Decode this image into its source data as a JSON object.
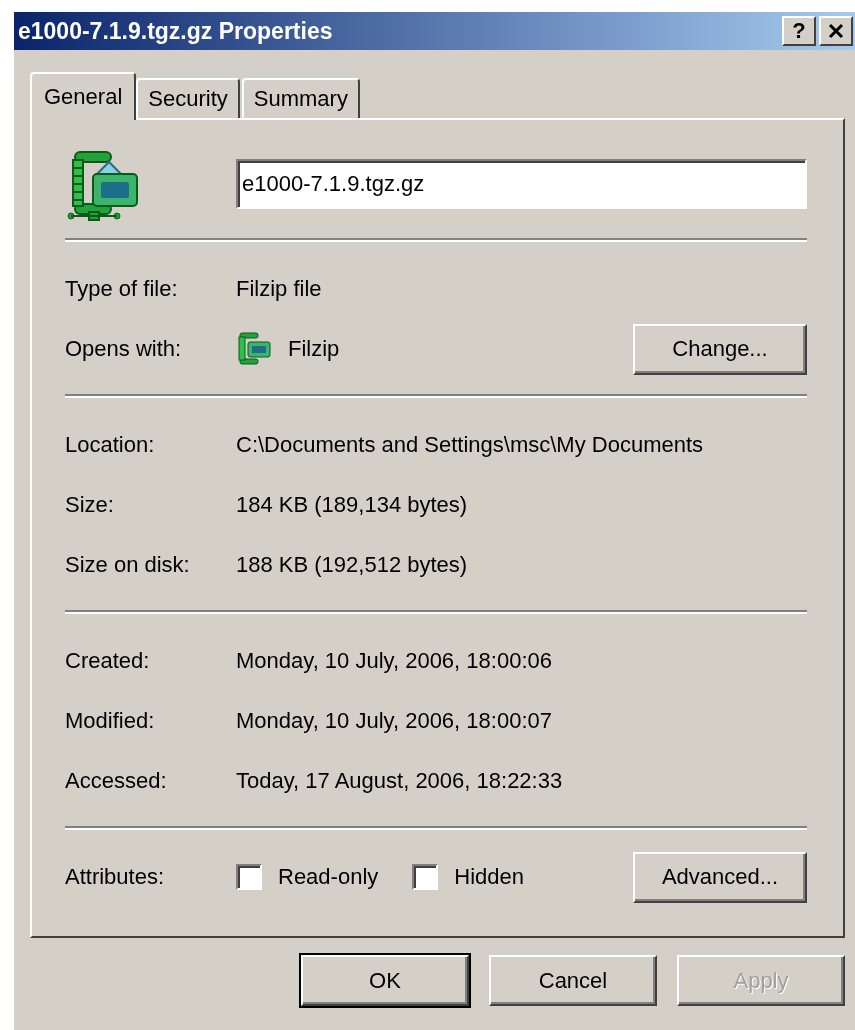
{
  "window": {
    "title": "e1000-7.1.9.tgz.gz Properties",
    "help_button": "?"
  },
  "tabs": [
    {
      "label": "General",
      "selected": true
    },
    {
      "label": "Security",
      "selected": false
    },
    {
      "label": "Summary",
      "selected": false
    }
  ],
  "file_name": {
    "value": "e1000-7.1.9.tgz.gz"
  },
  "sections": [
    [
      {
        "kind": "text",
        "label": "Type of file:",
        "value": "Filzip file"
      },
      {
        "kind": "app",
        "label": "Opens with:",
        "value": "Filzip",
        "button": "Change..."
      }
    ],
    [
      {
        "kind": "text",
        "label": "Location:",
        "value": "C:\\Documents and Settings\\msc\\My Documents"
      },
      {
        "kind": "text",
        "label": "Size:",
        "value": "184 KB (189,134 bytes)"
      },
      {
        "kind": "text",
        "label": "Size on disk:",
        "value": "188 KB (192,512 bytes)"
      }
    ],
    [
      {
        "kind": "text",
        "label": "Created:",
        "value": "Monday, 10 July, 2006, 18:00:06"
      },
      {
        "kind": "text",
        "label": "Modified:",
        "value": "Monday, 10 July, 2006, 18:00:07"
      },
      {
        "kind": "text",
        "label": "Accessed:",
        "value": "Today, 17 August, 2006, 18:22:33"
      }
    ],
    [
      {
        "kind": "attributes",
        "label": "Attributes:",
        "checkboxes": [
          {
            "label": "Read-only",
            "checked": false
          },
          {
            "label": "Hidden",
            "checked": false
          }
        ],
        "button": "Advanced..."
      }
    ]
  ],
  "buttons": [
    {
      "label": "OK",
      "default": true,
      "disabled": false
    },
    {
      "label": "Cancel",
      "default": false,
      "disabled": false
    },
    {
      "label": "Apply",
      "default": false,
      "disabled": true
    }
  ]
}
